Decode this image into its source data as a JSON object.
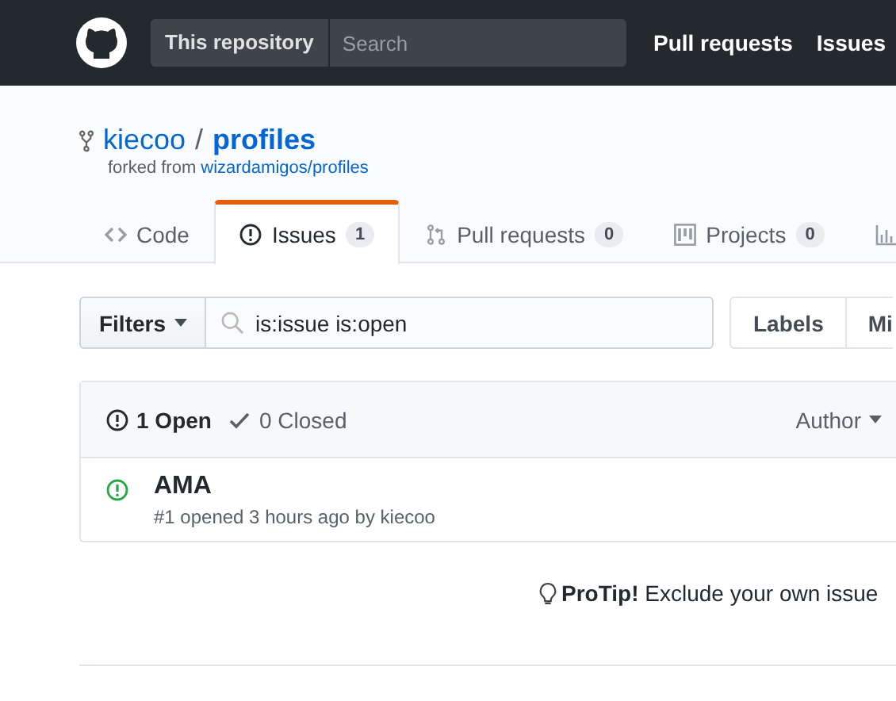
{
  "header": {
    "scope": "This repository",
    "search": {
      "placeholder": "Search"
    },
    "nav": [
      "Pull requests",
      "Issues"
    ]
  },
  "repo": {
    "owner": "kiecoo",
    "separator": "/",
    "name": "profiles",
    "forked_label": "forked from",
    "forked_from": "wizardamigos/profiles"
  },
  "tabs": [
    {
      "kind": "code",
      "label": "Code",
      "selected": false
    },
    {
      "kind": "issue",
      "label": "Issues",
      "count": "1",
      "selected": true
    },
    {
      "kind": "pull",
      "label": "Pull requests",
      "count": "0",
      "selected": false
    },
    {
      "kind": "project",
      "label": "Projects",
      "count": "0",
      "selected": false
    },
    {
      "kind": "graph",
      "selected": false
    }
  ],
  "filters": {
    "button": "Filters",
    "query": "is:issue is:open",
    "buttons": [
      "Labels",
      "Mi"
    ]
  },
  "issues": {
    "states": [
      {
        "kind": "open",
        "label": "1 Open",
        "selected": true
      },
      {
        "kind": "closed",
        "label": "0 Closed",
        "selected": false
      }
    ],
    "sort": "Author",
    "items": [
      {
        "title": "AMA",
        "meta": "#1 opened 3 hours ago by kiecoo",
        "open": true
      }
    ]
  },
  "protip": "**ProTip!** Exclude your own issue"
}
